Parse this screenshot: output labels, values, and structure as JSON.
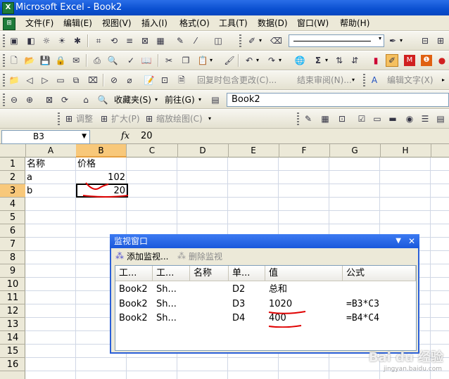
{
  "window": {
    "title": "Microsoft Excel - Book2",
    "app_icon_letter": "X"
  },
  "menu": {
    "items": [
      "文件(F)",
      "编辑(E)",
      "视图(V)",
      "插入(I)",
      "格式(O)",
      "工具(T)",
      "数据(D)",
      "窗口(W)",
      "帮助(H)"
    ]
  },
  "toolbars": {
    "reviewing": {
      "include_changes": "回复时包含更改(C)...",
      "end_review": "结束审阅(N)...",
      "edit_text": "编辑文字(X)"
    },
    "web": {
      "favorites": "收藏夹(S)",
      "go": "前往(G)",
      "address": "Book2"
    },
    "drawing_canvas": {
      "adjust": "调整",
      "expand": "扩大(P)",
      "scale": "缩放绘图(C)"
    }
  },
  "formula_bar": {
    "name_box": "B3",
    "fx": "fx",
    "value": "20"
  },
  "grid": {
    "columns": [
      "A",
      "B",
      "C",
      "D",
      "E",
      "F",
      "G",
      "H"
    ],
    "rows": [
      "1",
      "2",
      "3",
      "4",
      "5",
      "6",
      "7",
      "8",
      "9",
      "10",
      "11",
      "12",
      "13",
      "14",
      "15",
      "16"
    ],
    "cells": {
      "A1": "名称",
      "B1": "价格",
      "A2": "a",
      "B2": "102",
      "A3": "b",
      "B3": "20"
    },
    "selected": "B3"
  },
  "watch_window": {
    "title": "监视窗口",
    "add_watch": "添加监视...",
    "delete_watch": "删除监视",
    "headers": [
      "工...",
      "工...",
      "名称",
      "单...",
      "值",
      "公式"
    ],
    "rows": [
      {
        "book": "Book2",
        "sheet": "Sh...",
        "name": "",
        "cell": "D2",
        "value": "总和",
        "formula": ""
      },
      {
        "book": "Book2",
        "sheet": "Sh...",
        "name": "",
        "cell": "D3",
        "value": "1020",
        "formula": "=B3*C3"
      },
      {
        "book": "Book2",
        "sheet": "Sh...",
        "name": "",
        "cell": "D4",
        "value": "400",
        "formula": "=B4*C4"
      }
    ]
  },
  "colors": {
    "title_bar": "#0a4fd0",
    "selection_header": "#f8c87a",
    "annotation": "#e00000"
  },
  "watermark": {
    "line1": "Bai du 经验",
    "line2": "jingyan.baidu.com"
  }
}
